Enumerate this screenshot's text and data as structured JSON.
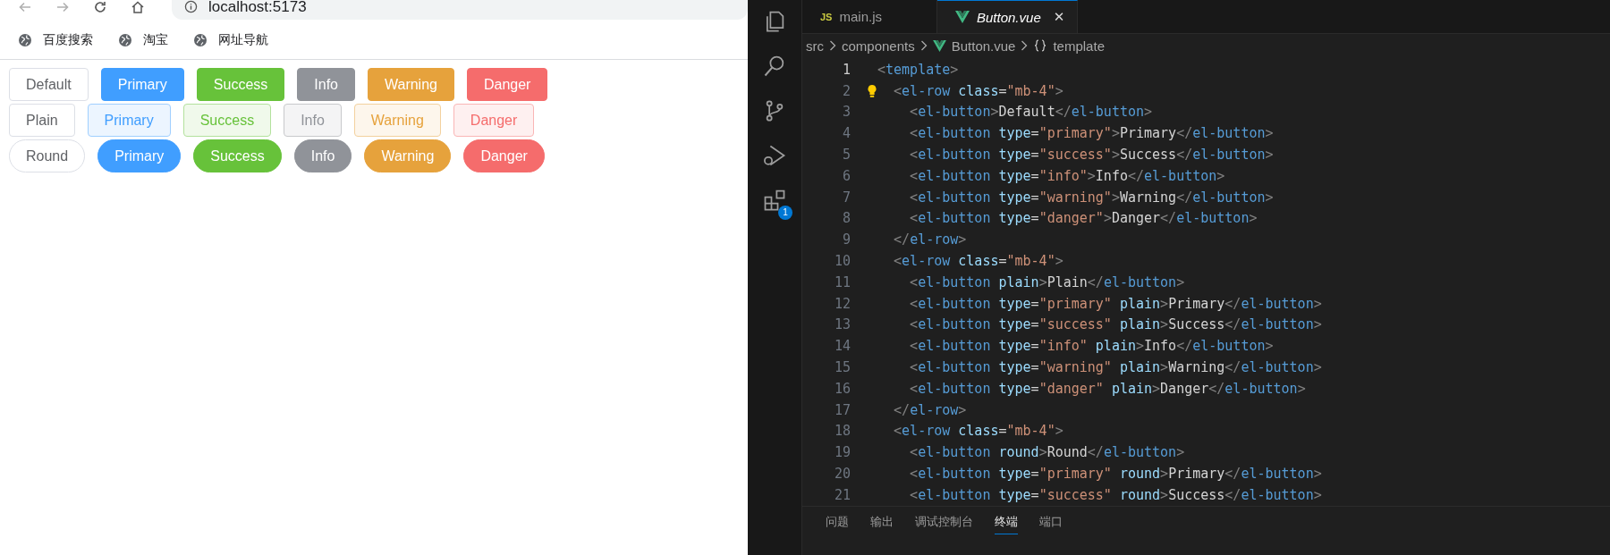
{
  "browser": {
    "address": "localhost:5173",
    "bookmarks": [
      "百度搜索",
      "淘宝",
      "网址导航"
    ],
    "button_rows": [
      {
        "kind": "solid",
        "buttons": [
          {
            "kind": "default",
            "label": "Default"
          },
          {
            "kind": "primary",
            "label": "Primary"
          },
          {
            "kind": "success",
            "label": "Success"
          },
          {
            "kind": "info",
            "label": "Info"
          },
          {
            "kind": "warning",
            "label": "Warning"
          },
          {
            "kind": "danger",
            "label": "Danger"
          }
        ]
      },
      {
        "kind": "plain",
        "buttons": [
          {
            "kind": "default",
            "label": "Plain"
          },
          {
            "kind": "primary",
            "label": "Primary"
          },
          {
            "kind": "success",
            "label": "Success"
          },
          {
            "kind": "info",
            "label": "Info"
          },
          {
            "kind": "warning",
            "label": "Warning"
          },
          {
            "kind": "danger",
            "label": "Danger"
          }
        ]
      },
      {
        "kind": "round",
        "buttons": [
          {
            "kind": "default",
            "label": "Round"
          },
          {
            "kind": "primary",
            "label": "Primary"
          },
          {
            "kind": "success",
            "label": "Success"
          },
          {
            "kind": "info",
            "label": "Info"
          },
          {
            "kind": "warning",
            "label": "Warning"
          },
          {
            "kind": "danger",
            "label": "Danger"
          }
        ]
      }
    ]
  },
  "editor": {
    "extensions_badge": "1",
    "tabs": [
      {
        "kind": "js",
        "icon_text": "JS",
        "label": "main.js",
        "selected": false
      },
      {
        "kind": "vue",
        "label": "Button.vue",
        "close": "✕",
        "selected": true
      }
    ],
    "breadcrumbs": [
      {
        "kind": "folder",
        "label": "src"
      },
      {
        "kind": "folder",
        "label": "components"
      },
      {
        "kind": "vue",
        "label": "Button.vue"
      },
      {
        "kind": "braces",
        "label": "template"
      }
    ],
    "lines": [
      {
        "n": "1",
        "current": true,
        "tokens": [
          {
            "kind": "punct",
            "text": "<"
          },
          {
            "kind": "tag",
            "text": "template"
          },
          {
            "kind": "punct",
            "text": ">"
          }
        ]
      },
      {
        "n": "2",
        "current": false,
        "lightbulb": true,
        "tokens": [
          {
            "kind": "punct",
            "text": "  <"
          },
          {
            "kind": "tag",
            "text": "el-row"
          },
          {
            "kind": "attr",
            "text": " class"
          },
          {
            "kind": "text",
            "text": "="
          },
          {
            "kind": "string",
            "text": "\"mb-4\""
          },
          {
            "kind": "punct",
            "text": ">"
          }
        ]
      },
      {
        "n": "3",
        "current": false,
        "tokens": [
          {
            "kind": "punct",
            "text": "    <"
          },
          {
            "kind": "tag",
            "text": "el-button"
          },
          {
            "kind": "punct",
            "text": ">"
          },
          {
            "kind": "text",
            "text": "Default"
          },
          {
            "kind": "punct",
            "text": "</"
          },
          {
            "kind": "tag",
            "text": "el-button"
          },
          {
            "kind": "punct",
            "text": ">"
          }
        ]
      },
      {
        "n": "4",
        "current": false,
        "tokens": [
          {
            "kind": "punct",
            "text": "    <"
          },
          {
            "kind": "tag",
            "text": "el-button"
          },
          {
            "kind": "attr",
            "text": " type"
          },
          {
            "kind": "text",
            "text": "="
          },
          {
            "kind": "string",
            "text": "\"primary\""
          },
          {
            "kind": "punct",
            "text": ">"
          },
          {
            "kind": "text",
            "text": "Primary"
          },
          {
            "kind": "punct",
            "text": "</"
          },
          {
            "kind": "tag",
            "text": "el-button"
          },
          {
            "kind": "punct",
            "text": ">"
          }
        ]
      },
      {
        "n": "5",
        "current": false,
        "tokens": [
          {
            "kind": "punct",
            "text": "    <"
          },
          {
            "kind": "tag",
            "text": "el-button"
          },
          {
            "kind": "attr",
            "text": " type"
          },
          {
            "kind": "text",
            "text": "="
          },
          {
            "kind": "string",
            "text": "\"success\""
          },
          {
            "kind": "punct",
            "text": ">"
          },
          {
            "kind": "text",
            "text": "Success"
          },
          {
            "kind": "punct",
            "text": "</"
          },
          {
            "kind": "tag",
            "text": "el-button"
          },
          {
            "kind": "punct",
            "text": ">"
          }
        ]
      },
      {
        "n": "6",
        "current": false,
        "tokens": [
          {
            "kind": "punct",
            "text": "    <"
          },
          {
            "kind": "tag",
            "text": "el-button"
          },
          {
            "kind": "attr",
            "text": " type"
          },
          {
            "kind": "text",
            "text": "="
          },
          {
            "kind": "string",
            "text": "\"info\""
          },
          {
            "kind": "punct",
            "text": ">"
          },
          {
            "kind": "text",
            "text": "Info"
          },
          {
            "kind": "punct",
            "text": "</"
          },
          {
            "kind": "tag",
            "text": "el-button"
          },
          {
            "kind": "punct",
            "text": ">"
          }
        ]
      },
      {
        "n": "7",
        "current": false,
        "tokens": [
          {
            "kind": "punct",
            "text": "    <"
          },
          {
            "kind": "tag",
            "text": "el-button"
          },
          {
            "kind": "attr",
            "text": " type"
          },
          {
            "kind": "text",
            "text": "="
          },
          {
            "kind": "string",
            "text": "\"warning\""
          },
          {
            "kind": "punct",
            "text": ">"
          },
          {
            "kind": "text",
            "text": "Warning"
          },
          {
            "kind": "punct",
            "text": "</"
          },
          {
            "kind": "tag",
            "text": "el-button"
          },
          {
            "kind": "punct",
            "text": ">"
          }
        ]
      },
      {
        "n": "8",
        "current": false,
        "tokens": [
          {
            "kind": "punct",
            "text": "    <"
          },
          {
            "kind": "tag",
            "text": "el-button"
          },
          {
            "kind": "attr",
            "text": " type"
          },
          {
            "kind": "text",
            "text": "="
          },
          {
            "kind": "string",
            "text": "\"danger\""
          },
          {
            "kind": "punct",
            "text": ">"
          },
          {
            "kind": "text",
            "text": "Danger"
          },
          {
            "kind": "punct",
            "text": "</"
          },
          {
            "kind": "tag",
            "text": "el-button"
          },
          {
            "kind": "punct",
            "text": ">"
          }
        ]
      },
      {
        "n": "9",
        "current": false,
        "tokens": [
          {
            "kind": "punct",
            "text": "  </"
          },
          {
            "kind": "tag",
            "text": "el-row"
          },
          {
            "kind": "punct",
            "text": ">"
          }
        ]
      },
      {
        "n": "10",
        "current": false,
        "tokens": [
          {
            "kind": "punct",
            "text": "  <"
          },
          {
            "kind": "tag",
            "text": "el-row"
          },
          {
            "kind": "attr",
            "text": " class"
          },
          {
            "kind": "text",
            "text": "="
          },
          {
            "kind": "string",
            "text": "\"mb-4\""
          },
          {
            "kind": "punct",
            "text": ">"
          }
        ]
      },
      {
        "n": "11",
        "current": false,
        "tokens": [
          {
            "kind": "punct",
            "text": "    <"
          },
          {
            "kind": "tag",
            "text": "el-button"
          },
          {
            "kind": "attr",
            "text": " plain"
          },
          {
            "kind": "punct",
            "text": ">"
          },
          {
            "kind": "text",
            "text": "Plain"
          },
          {
            "kind": "punct",
            "text": "</"
          },
          {
            "kind": "tag",
            "text": "el-button"
          },
          {
            "kind": "punct",
            "text": ">"
          }
        ]
      },
      {
        "n": "12",
        "current": false,
        "tokens": [
          {
            "kind": "punct",
            "text": "    <"
          },
          {
            "kind": "tag",
            "text": "el-button"
          },
          {
            "kind": "attr",
            "text": " type"
          },
          {
            "kind": "text",
            "text": "="
          },
          {
            "kind": "string",
            "text": "\"primary\""
          },
          {
            "kind": "attr",
            "text": " plain"
          },
          {
            "kind": "punct",
            "text": ">"
          },
          {
            "kind": "text",
            "text": "Primary"
          },
          {
            "kind": "punct",
            "text": "</"
          },
          {
            "kind": "tag",
            "text": "el-button"
          },
          {
            "kind": "punct",
            "text": ">"
          }
        ]
      },
      {
        "n": "13",
        "current": false,
        "tokens": [
          {
            "kind": "punct",
            "text": "    <"
          },
          {
            "kind": "tag",
            "text": "el-button"
          },
          {
            "kind": "attr",
            "text": " type"
          },
          {
            "kind": "text",
            "text": "="
          },
          {
            "kind": "string",
            "text": "\"success\""
          },
          {
            "kind": "attr",
            "text": " plain"
          },
          {
            "kind": "punct",
            "text": ">"
          },
          {
            "kind": "text",
            "text": "Success"
          },
          {
            "kind": "punct",
            "text": "</"
          },
          {
            "kind": "tag",
            "text": "el-button"
          },
          {
            "kind": "punct",
            "text": ">"
          }
        ]
      },
      {
        "n": "14",
        "current": false,
        "tokens": [
          {
            "kind": "punct",
            "text": "    <"
          },
          {
            "kind": "tag",
            "text": "el-button"
          },
          {
            "kind": "attr",
            "text": " type"
          },
          {
            "kind": "text",
            "text": "="
          },
          {
            "kind": "string",
            "text": "\"info\""
          },
          {
            "kind": "attr",
            "text": " plain"
          },
          {
            "kind": "punct",
            "text": ">"
          },
          {
            "kind": "text",
            "text": "Info"
          },
          {
            "kind": "punct",
            "text": "</"
          },
          {
            "kind": "tag",
            "text": "el-button"
          },
          {
            "kind": "punct",
            "text": ">"
          }
        ]
      },
      {
        "n": "15",
        "current": false,
        "tokens": [
          {
            "kind": "punct",
            "text": "    <"
          },
          {
            "kind": "tag",
            "text": "el-button"
          },
          {
            "kind": "attr",
            "text": " type"
          },
          {
            "kind": "text",
            "text": "="
          },
          {
            "kind": "string",
            "text": "\"warning\""
          },
          {
            "kind": "attr",
            "text": " plain"
          },
          {
            "kind": "punct",
            "text": ">"
          },
          {
            "kind": "text",
            "text": "Warning"
          },
          {
            "kind": "punct",
            "text": "</"
          },
          {
            "kind": "tag",
            "text": "el-button"
          },
          {
            "kind": "punct",
            "text": ">"
          }
        ]
      },
      {
        "n": "16",
        "current": false,
        "tokens": [
          {
            "kind": "punct",
            "text": "    <"
          },
          {
            "kind": "tag",
            "text": "el-button"
          },
          {
            "kind": "attr",
            "text": " type"
          },
          {
            "kind": "text",
            "text": "="
          },
          {
            "kind": "string",
            "text": "\"danger\""
          },
          {
            "kind": "attr",
            "text": " plain"
          },
          {
            "kind": "punct",
            "text": ">"
          },
          {
            "kind": "text",
            "text": "Danger"
          },
          {
            "kind": "punct",
            "text": "</"
          },
          {
            "kind": "tag",
            "text": "el-button"
          },
          {
            "kind": "punct",
            "text": ">"
          }
        ]
      },
      {
        "n": "17",
        "current": false,
        "tokens": [
          {
            "kind": "punct",
            "text": "  </"
          },
          {
            "kind": "tag",
            "text": "el-row"
          },
          {
            "kind": "punct",
            "text": ">"
          }
        ]
      },
      {
        "n": "18",
        "current": false,
        "tokens": [
          {
            "kind": "punct",
            "text": "  <"
          },
          {
            "kind": "tag",
            "text": "el-row"
          },
          {
            "kind": "attr",
            "text": " class"
          },
          {
            "kind": "text",
            "text": "="
          },
          {
            "kind": "string",
            "text": "\"mb-4\""
          },
          {
            "kind": "punct",
            "text": ">"
          }
        ]
      },
      {
        "n": "19",
        "current": false,
        "tokens": [
          {
            "kind": "punct",
            "text": "    <"
          },
          {
            "kind": "tag",
            "text": "el-button"
          },
          {
            "kind": "attr",
            "text": " round"
          },
          {
            "kind": "punct",
            "text": ">"
          },
          {
            "kind": "text",
            "text": "Round"
          },
          {
            "kind": "punct",
            "text": "</"
          },
          {
            "kind": "tag",
            "text": "el-button"
          },
          {
            "kind": "punct",
            "text": ">"
          }
        ]
      },
      {
        "n": "20",
        "current": false,
        "tokens": [
          {
            "kind": "punct",
            "text": "    <"
          },
          {
            "kind": "tag",
            "text": "el-button"
          },
          {
            "kind": "attr",
            "text": " type"
          },
          {
            "kind": "text",
            "text": "="
          },
          {
            "kind": "string",
            "text": "\"primary\""
          },
          {
            "kind": "attr",
            "text": " round"
          },
          {
            "kind": "punct",
            "text": ">"
          },
          {
            "kind": "text",
            "text": "Primary"
          },
          {
            "kind": "punct",
            "text": "</"
          },
          {
            "kind": "tag",
            "text": "el-button"
          },
          {
            "kind": "punct",
            "text": ">"
          }
        ]
      },
      {
        "n": "21",
        "current": false,
        "tokens": [
          {
            "kind": "punct",
            "text": "    <"
          },
          {
            "kind": "tag",
            "text": "el-button"
          },
          {
            "kind": "attr",
            "text": " type"
          },
          {
            "kind": "text",
            "text": "="
          },
          {
            "kind": "string",
            "text": "\"success\""
          },
          {
            "kind": "attr",
            "text": " round"
          },
          {
            "kind": "punct",
            "text": ">"
          },
          {
            "kind": "text",
            "text": "Success"
          },
          {
            "kind": "punct",
            "text": "</"
          },
          {
            "kind": "tag",
            "text": "el-button"
          },
          {
            "kind": "punct",
            "text": ">"
          }
        ]
      }
    ],
    "panel_tabs": [
      {
        "label": "问题",
        "selected": false
      },
      {
        "label": "输出",
        "selected": false
      },
      {
        "label": "调试控制台",
        "selected": false
      },
      {
        "label": "终端",
        "selected": true
      },
      {
        "label": "端口",
        "selected": false
      }
    ]
  }
}
